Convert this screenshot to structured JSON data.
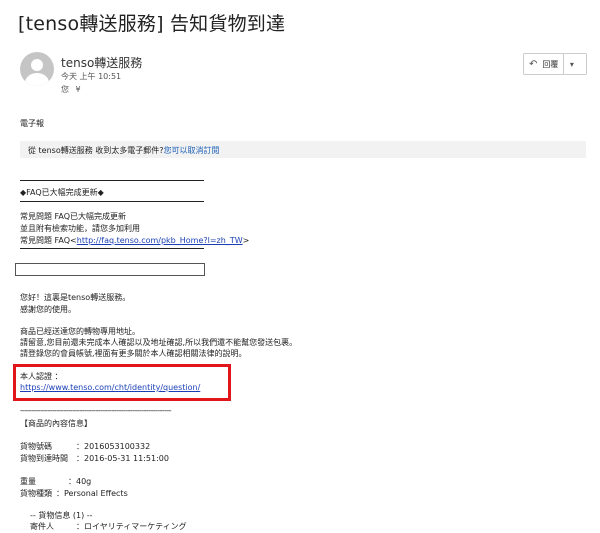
{
  "email": {
    "subject": "[tenso轉送服務] 告知貨物到達",
    "sender": "tenso轉送服務",
    "date": "今天 上午 10:51",
    "to_label": "您",
    "reply_label": "回覆",
    "label_line": "電子報",
    "banner_text": "從 tenso轉送服務 收到太多電子郵件?",
    "banner_link": "您可以取消訂閱"
  },
  "body": {
    "faq_heading": "◆FAQ已大幅完成更新◆",
    "faq_line1": "常見問題 FAQ已大幅完成更新",
    "faq_line2": "並且附有檢索功能，請您多加利用",
    "faq_line3_prefix": "常見問題 FAQ<",
    "faq_link": "http://faq.tenso.com/pkb_Home?l=zh_TW",
    "faq_line3_suffix": ">",
    "greeting1": "您好！這裏是tenso轉送服務。",
    "greeting2": "感謝您的使用。",
    "notice1": "商品已經送達您的轉物專用地址。",
    "notice2": "請留意,您目前還未完成本人確認以及地址確認,所以我們還不能幫您發送包裹。",
    "notice3": "請登錄您的會員帳號,裡面有更多關於本人確認相關法律的說明。",
    "verify_label": "本人認證 ：",
    "verify_link": "https://www.tenso.com/cht/identity/question/",
    "divider": "------------------------------------------------------------------",
    "item_info_title": "【商品的內容信息】",
    "cargo_no_label": "貨物號碼",
    "cargo_no_value": "：2016053100332",
    "arrival_label": "貨物到達時間",
    "arrival_value": "：2016-05-31 11:51:00",
    "weight_label": "重量",
    "weight_value": "：40g",
    "category_label": "貨物種類",
    "category_value": "：Personal Effects",
    "cargo_info": "-- 貨物信息 (1) --",
    "sender_label": "寄件人",
    "sender_value": "：ロイヤリティマーケティング"
  }
}
